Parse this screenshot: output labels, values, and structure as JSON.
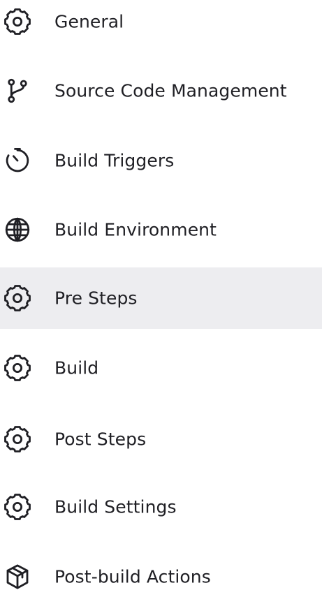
{
  "sidebar": {
    "items": [
      {
        "label": "General",
        "icon": "gear-icon",
        "active": false
      },
      {
        "label": "Source Code Management",
        "icon": "git-branch-icon",
        "active": false
      },
      {
        "label": "Build Triggers",
        "icon": "timer-icon",
        "active": false
      },
      {
        "label": "Build Environment",
        "icon": "globe-icon",
        "active": false
      },
      {
        "label": "Pre Steps",
        "icon": "gear-icon",
        "active": true
      },
      {
        "label": "Build",
        "icon": "gear-icon",
        "active": false
      },
      {
        "label": "Post Steps",
        "icon": "gear-icon",
        "active": false
      },
      {
        "label": "Build Settings",
        "icon": "gear-icon",
        "active": false
      },
      {
        "label": "Post-build Actions",
        "icon": "package-icon",
        "active": false
      }
    ],
    "active_background": "#ededf0",
    "text_color": "#1f1f24"
  }
}
